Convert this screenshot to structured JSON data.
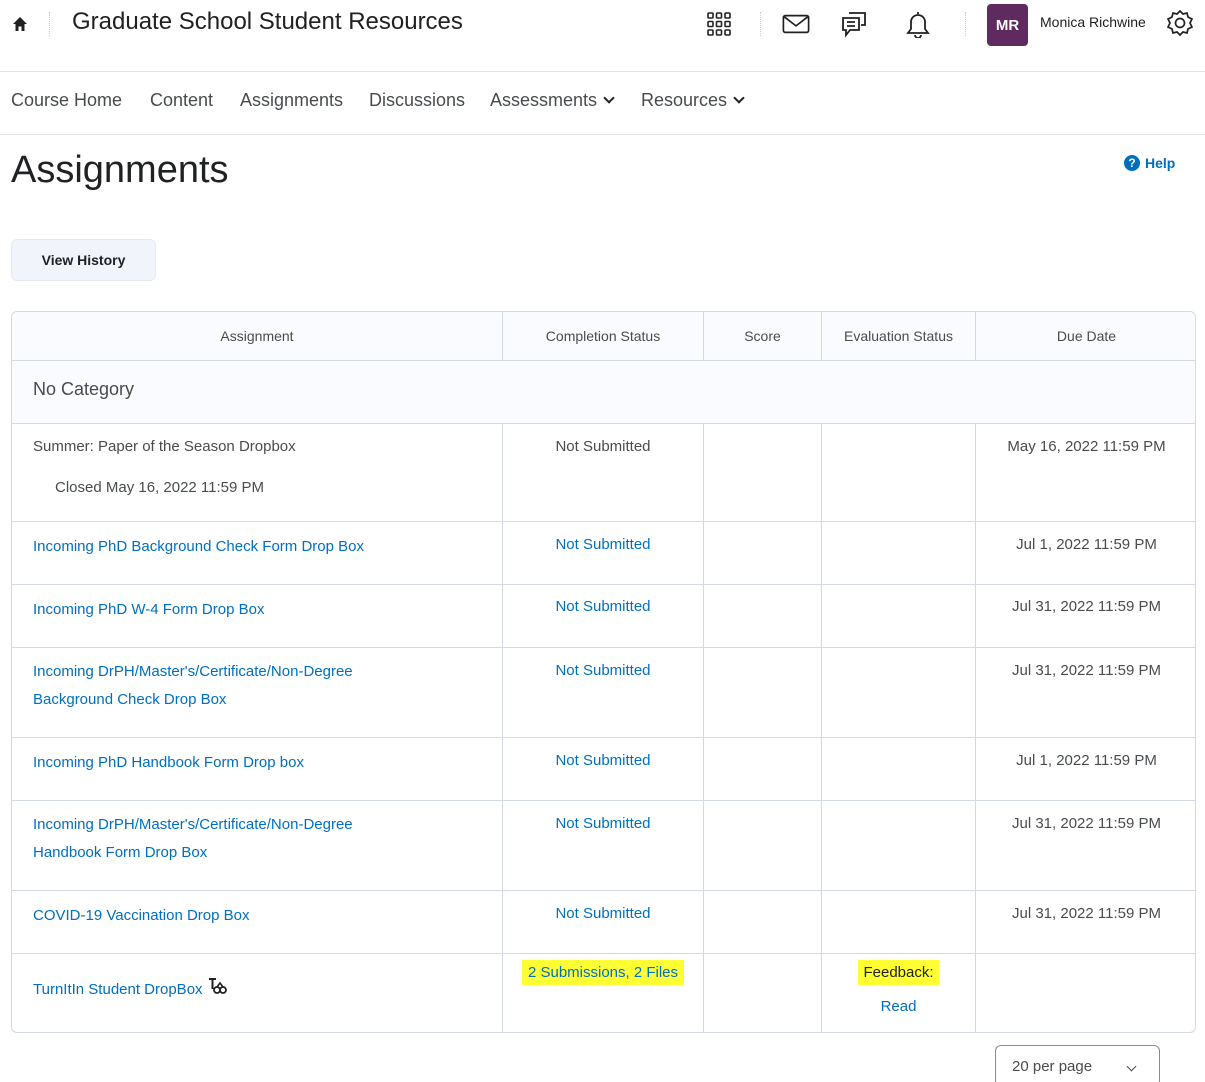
{
  "header": {
    "course_title": "Graduate School Student Resources",
    "user_initials": "MR",
    "user_name": "Monica Richwine",
    "avatar_color": "#5e2a60",
    "icons": [
      "home-icon",
      "waffle-icon",
      "mail-icon",
      "discussion-icon",
      "bell-icon",
      "gear-icon"
    ]
  },
  "nav": {
    "items": [
      {
        "label": "Course Home"
      },
      {
        "label": "Content"
      },
      {
        "label": "Assignments"
      },
      {
        "label": "Discussions"
      },
      {
        "label": "Assessments",
        "dropdown": true
      },
      {
        "label": "Resources",
        "dropdown": true
      }
    ]
  },
  "page": {
    "title": "Assignments",
    "help_label": "Help",
    "view_history_label": "View History"
  },
  "table": {
    "columns": [
      "Assignment",
      "Completion Status",
      "Score",
      "Evaluation Status",
      "Due Date"
    ],
    "category": "No Category",
    "rows": [
      {
        "name": "Summer: Paper of the Season Dropbox",
        "sub": "Closed May 16, 2022 11:59 PM",
        "is_link": false,
        "completion": "Not Submitted",
        "score": "",
        "evaluation": "",
        "due": "May 16, 2022 11:59 PM"
      },
      {
        "name": "Incoming PhD Background Check Form Drop Box",
        "is_link": true,
        "completion": "Not Submitted",
        "score": "",
        "evaluation": "",
        "due": "Jul 1, 2022 11:59 PM"
      },
      {
        "name": "Incoming PhD W-4 Form Drop Box",
        "is_link": true,
        "completion": "Not Submitted",
        "score": "",
        "evaluation": "",
        "due": "Jul 31, 2022 11:59 PM"
      },
      {
        "name_line1": "Incoming DrPH/Master's/Certificate/Non-Degree",
        "name_line2": "Background Check Drop Box",
        "is_link": true,
        "completion": "Not Submitted",
        "score": "",
        "evaluation": "",
        "due": "Jul 31, 2022 11:59 PM"
      },
      {
        "name": "Incoming PhD Handbook Form Drop box",
        "is_link": true,
        "completion": "Not Submitted",
        "score": "",
        "evaluation": "",
        "due": "Jul 1, 2022 11:59 PM"
      },
      {
        "name_line1": "Incoming DrPH/Master's/Certificate/Non-Degree",
        "name_line2": "Handbook Form Drop Box",
        "is_link": true,
        "completion": "Not Submitted",
        "score": "",
        "evaluation": "",
        "due": "Jul 31, 2022 11:59 PM"
      },
      {
        "name": "COVID-19 Vaccination Drop Box",
        "is_link": true,
        "completion": "Not Submitted",
        "score": "",
        "evaluation": "",
        "due": "Jul 31, 2022 11:59 PM"
      },
      {
        "name": "TurnItIn Student DropBox",
        "is_link": true,
        "completion": "2 Submissions, 2 Files",
        "completion_highlight": true,
        "score": "",
        "evaluation_label": "Feedback:",
        "evaluation_link": "Read",
        "due": ""
      }
    ]
  },
  "pager": {
    "selected": "20 per page"
  },
  "colors": {
    "link": "#006fbf",
    "highlight": "#ffff33",
    "header_bg": "#f9fbff",
    "border": "#d3d9e3"
  }
}
